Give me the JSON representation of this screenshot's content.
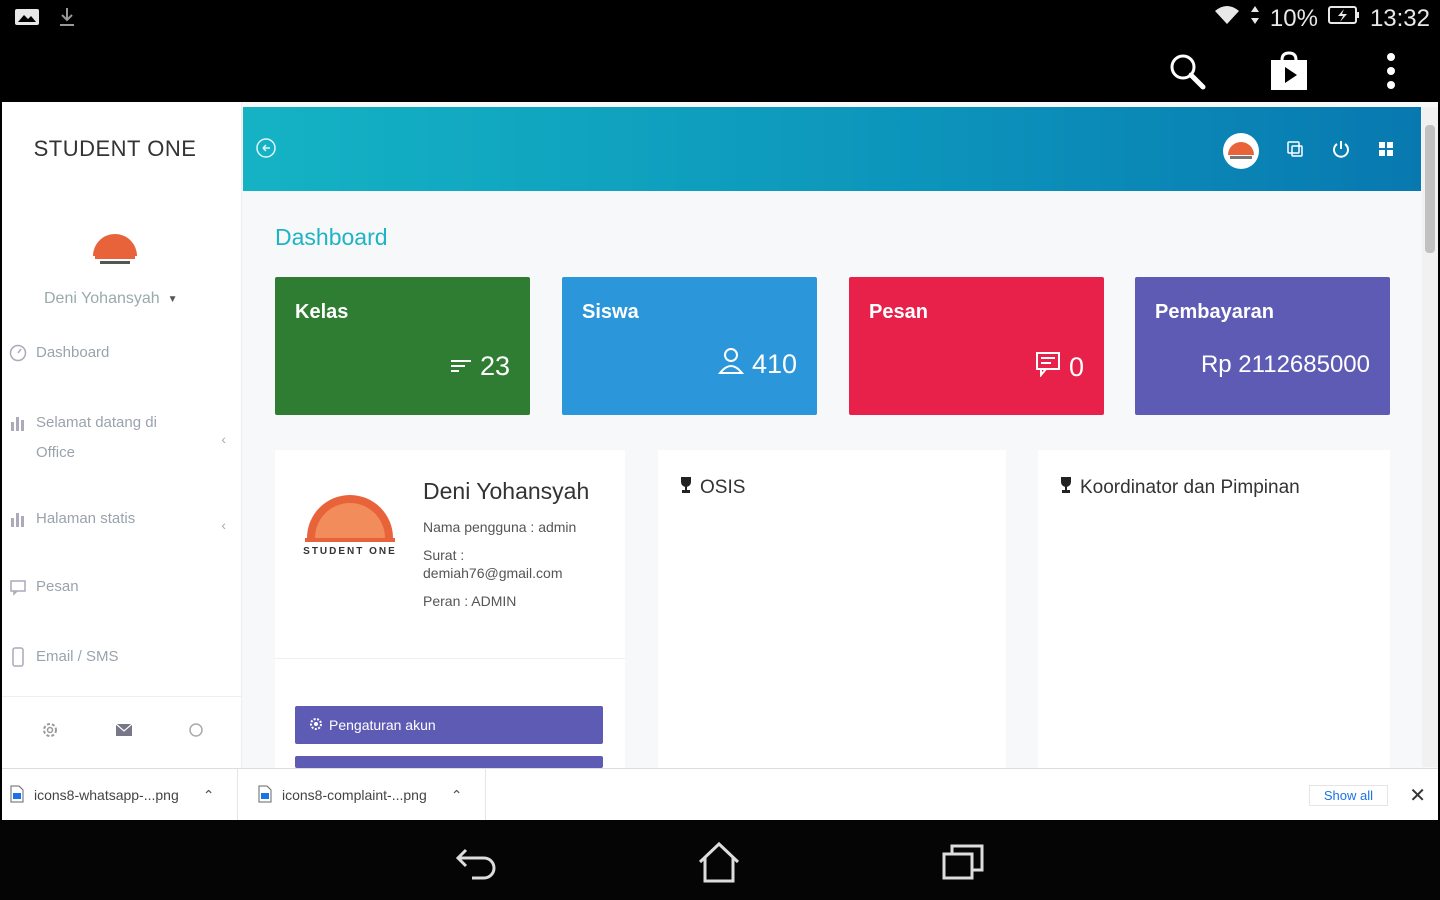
{
  "status": {
    "battery_pct": "10%",
    "time": "13:32"
  },
  "sidebar": {
    "brand": "STUDENT ONE",
    "user": "Deni Yohansyah",
    "items": [
      {
        "label": "Dashboard",
        "icon": "dashboard-icon"
      },
      {
        "label": "Selamat datang di Office",
        "icon": "bar-chart-icon"
      },
      {
        "label": "Halaman statis",
        "icon": "bar-chart-icon"
      },
      {
        "label": "Pesan",
        "icon": "message-icon"
      },
      {
        "label": "Email / SMS",
        "icon": "phone-icon"
      }
    ]
  },
  "main": {
    "title": "Dashboard",
    "stats": [
      {
        "label": "Kelas",
        "value": "23",
        "color": "#2e7d32"
      },
      {
        "label": "Siswa",
        "value": "410",
        "color": "#2b96d9"
      },
      {
        "label": "Pesan",
        "value": "0",
        "color": "#e8214a"
      },
      {
        "label": "Pembayaran",
        "value": "Rp 2112685000",
        "color": "#5e5bb5"
      }
    ],
    "profile": {
      "name": "Deni Yohansyah",
      "username": "Nama pengguna : admin",
      "email_label": "Surat :",
      "email": "demiah76@gmail.com",
      "role": "Peran : ADMIN",
      "logo_text": "STUDENT ONE",
      "button_account": "Pengaturan akun"
    },
    "panel_osis": "OSIS",
    "panel_koordinator": "Koordinator dan Pimpinan"
  },
  "downloads": {
    "items": [
      "icons8-whatsapp-...png",
      "icons8-complaint-...png"
    ],
    "show_all": "Show all"
  }
}
